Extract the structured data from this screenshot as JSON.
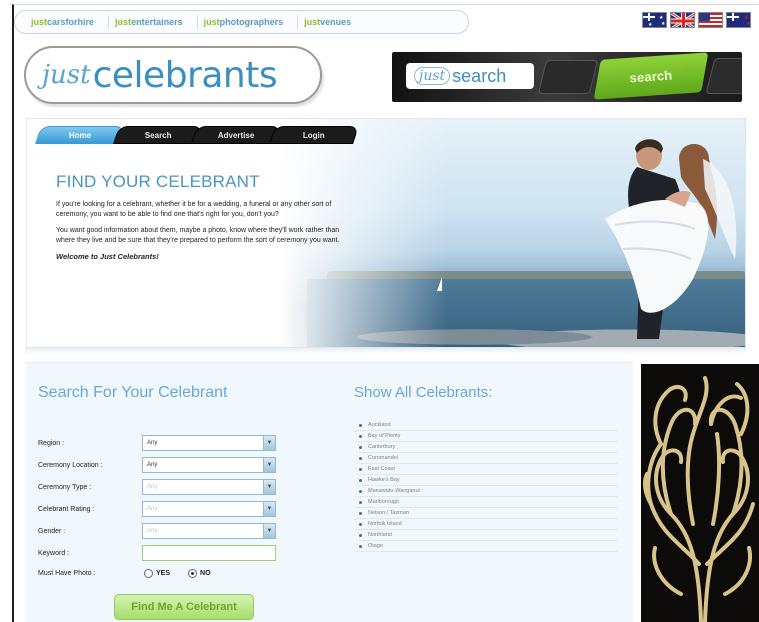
{
  "network_bar": {
    "links": [
      {
        "prefix": "just",
        "rest": "carsforhire"
      },
      {
        "prefix": "just",
        "rest": "entertainers"
      },
      {
        "prefix": "just",
        "rest": "photographers"
      },
      {
        "prefix": "just",
        "rest": "venues"
      }
    ]
  },
  "flags": [
    "australia-flag-icon",
    "uk-flag-icon",
    "usa-flag-icon",
    "new-zealand-flag-icon"
  ],
  "logo": {
    "just": "just",
    "name": "celebrants"
  },
  "search_banner": {
    "just": "just",
    "word": "search",
    "button_label": "search"
  },
  "nav": {
    "tabs": [
      "Home",
      "Search",
      "Advertise",
      "Login"
    ],
    "active": "Home"
  },
  "hero": {
    "title": "FIND YOUR CELEBRANT",
    "para1": "If you're looking for a celebrant, whether it be for a wedding, a funeral or any other sort of ceremony, you want to be able to find one that's right for you, don't you?",
    "para2": "You want good information about them, maybe a photo, know where they'll work rather than where they live and be sure that they're prepared to perform the sort of ceremony you want.",
    "welcome": "Welcome to Just Celebrants!"
  },
  "search_form": {
    "title": "Search For Your Celebrant",
    "fields": [
      {
        "label": "Region :",
        "value": "Any"
      },
      {
        "label": "Ceremony Location :",
        "value": "Any"
      },
      {
        "label": "Ceremony Type :",
        "value": "Any"
      },
      {
        "label": "Celebrant Rating :",
        "value": "Any"
      },
      {
        "label": "Gender :",
        "value": "Any"
      }
    ],
    "keyword_label": "Keyword :",
    "photo_label": "Must Have Photo :",
    "photo_options": [
      "YES",
      "NO"
    ],
    "photo_selected": "NO",
    "submit_label": "Find Me A Celebrant"
  },
  "show_all": {
    "title": "Show All Celebrants:",
    "items": [
      "Auckland",
      "Bay of Plenty",
      "Canterbury",
      "Coromandel",
      "East Coast",
      "Hawke's Bay",
      "Manawatu-Wanganui",
      "Marlborough",
      "Nelson / Tasman",
      "Norfolk Island",
      "Northland",
      "Otago"
    ]
  },
  "colors": {
    "accent_blue": "#4a94c3",
    "accent_green": "#8fbf2a",
    "panel_bg": "#f1f8fd"
  }
}
